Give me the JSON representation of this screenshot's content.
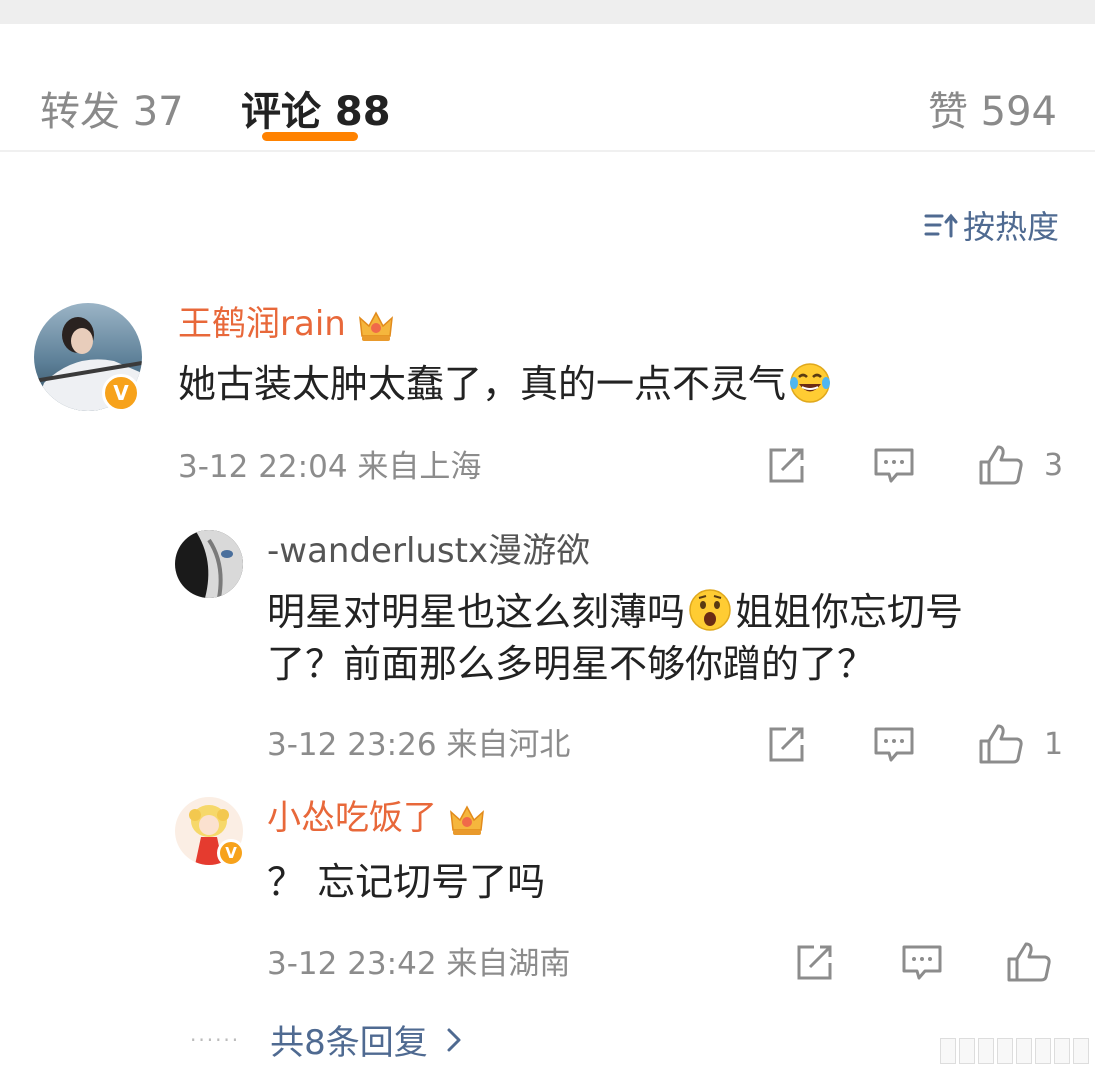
{
  "tabs": {
    "repost": "转发 37",
    "comment": "评论 88",
    "like": "赞 594"
  },
  "sort": {
    "label": "按热度"
  },
  "comments": [
    {
      "username": "王鹤润rain",
      "text": "她古装太肿太蠢了，真的一点不灵气",
      "emoji": "laugh-cry-emoji",
      "time": "3-12 22:04",
      "location": "来自上海",
      "likes": "3",
      "verified": "V"
    },
    {
      "username": "-wanderlustx漫游欲",
      "text_line1": "明星对明星也这么刻薄吗",
      "text_line1b": "姐姐你忘切号",
      "text_line2": "了？前面那么多明星不够你蹭的了？",
      "emoji": "shocked-emoji",
      "time": "3-12 23:26",
      "location": "来自河北",
      "likes": "1"
    },
    {
      "username": "小怂吃饭了",
      "text": "？ 忘记切号了吗",
      "time": "3-12 23:42",
      "location": "来自湖南",
      "likes": "",
      "verified": "V"
    }
  ],
  "more_replies": "共8条回复",
  "colors": {
    "accent": "#ff8200",
    "link": "#4f6a91",
    "vip_name": "#e8683a",
    "meta": "#8c8c8c"
  }
}
